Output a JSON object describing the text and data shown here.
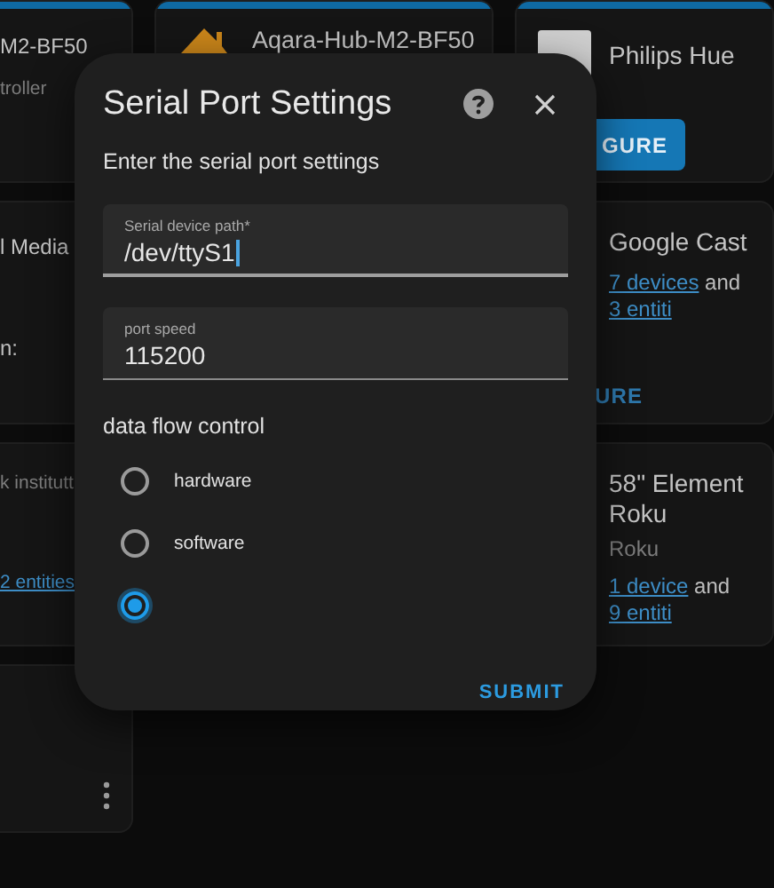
{
  "columns": [
    {
      "cards": [
        {
          "top_bar": true,
          "title": "M2-BF50",
          "subtitle": "troller"
        },
        {
          "top_bar": false,
          "title": "l Media",
          "detail": "n:"
        },
        {
          "top_bar": false,
          "subtitle": "k institutt",
          "summary": [
            {
              "kind": "link",
              "text": "2 entities"
            }
          ]
        },
        {
          "top_bar": false,
          "menu": true
        }
      ]
    },
    {
      "cards": [
        {
          "top_bar": true,
          "title": "Aqara-Hub-M2-BF50"
        }
      ]
    },
    {
      "cards": [
        {
          "top_bar": true,
          "title": "Philips Hue",
          "button": "GURE"
        },
        {
          "top_bar": false,
          "title": "Google Cast",
          "summary": [
            {
              "kind": "link",
              "text": "7 devices"
            },
            {
              "kind": "text",
              "text": "and"
            },
            {
              "kind": "link",
              "text": "3 entiti"
            }
          ],
          "text_button": "URE"
        },
        {
          "top_bar": false,
          "title": "58\" Element Roku",
          "subtitle": "Roku",
          "summary": [
            {
              "kind": "link",
              "text": "1 device"
            },
            {
              "kind": "text",
              "text": "and"
            },
            {
              "kind": "link",
              "text": "9 entiti"
            }
          ]
        }
      ]
    }
  ],
  "dialog": {
    "title": "Serial Port Settings",
    "subtitle": "Enter the serial port settings",
    "fields": [
      {
        "label": "Serial device path*",
        "value": "/dev/ttyS1",
        "focused": true
      },
      {
        "label": "port speed",
        "value": "115200",
        "focused": false
      }
    ],
    "group_label": "data flow control",
    "options": [
      {
        "label": "hardware",
        "selected": false
      },
      {
        "label": "software",
        "selected": false
      },
      {
        "selected": true
      }
    ],
    "submit": "SUBMIT"
  }
}
